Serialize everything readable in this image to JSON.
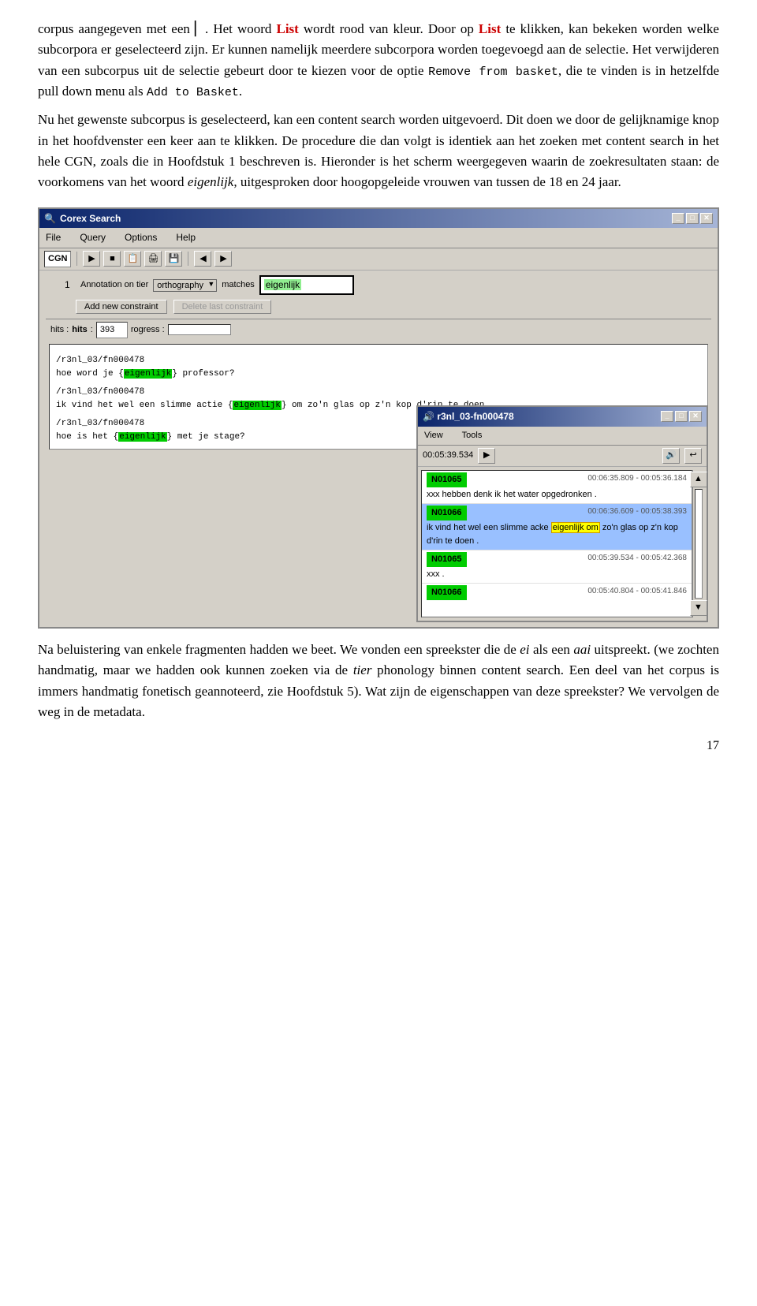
{
  "paragraph1": {
    "text": "corpus aangegeven met een"
  },
  "cursor_icon": "▏",
  "list_word": "List",
  "paragraph1_rest": ". Het woord List wordt rood van kleur. Door op List te klikken, kan bekeken worden welke subcorpora er geselecteerd zijn. Er kunnen namelijk meerdere subcorpora worden toegevoegd aan de selectie. Het verwijderen van een subcorpus uit de selectie gebeurt door te kiezen voor de optie",
  "remove_text": "Remove from basket",
  "remove_rest": ", die te vinden is in hetzelfde pull down menu als",
  "add_basket": "Add to Basket",
  "add_basket_rest": ".",
  "paragraph2": "Nu het gewenste subcorpus is geselecteerd, kan een content search worden uitgevoerd. Dit doen we door de gelijknamige knop in het hoofdvenster een keer aan te klikken. De procedure die dan volgt is identiek aan het zoeken met content search in het hele CGN, zoals die in Hoofdstuk 1 beschreven is. Hieronder is het scherm weergegeven waarin de zoekresultaten staan: de voorkomens van het woord",
  "eigenlijk_italic": "eigenlijk",
  "paragraph2_rest": ", uitgesproken door hoogopgeleide vrouwen van tussen de 18 en 24 jaar.",
  "corex_window": {
    "title": "Corex Search",
    "menu": [
      "File",
      "Query",
      "Options",
      "Help"
    ],
    "toolbar_corpus": "CGN",
    "query_row": {
      "number": "1",
      "annotation_label": "Annotation on tier",
      "tier_value": "orthography",
      "matches_label": "matches",
      "query_value": "eigenlijk"
    },
    "add_constraint_btn": "Add new constraint",
    "delete_constraint_btn": "Delete last constraint",
    "status": {
      "hits_label": "hits",
      "hits_colon": ":hits :",
      "hits_value": "393",
      "progress_label": "rogress :"
    },
    "results": [
      {
        "path": "/r3nl_03/fn000478",
        "text": "hoe word je {eigenlijk} professor?"
      },
      {
        "path": "/r3nl_03/fn000478",
        "text": "ik vind het wel een slimme actie {eigenlijk} om zo'n glas op z'n kop d'rin te doen."
      },
      {
        "path": "/r3nl_03/fn000478",
        "text": "hoe is het {eigenlijk} met je stage?"
      }
    ]
  },
  "sub_window": {
    "title": "r3nl_03-fn000478",
    "menu": [
      "View",
      "Tools"
    ],
    "time_display": "00:05:39.534",
    "items": [
      {
        "speaker": "N01065",
        "timestamp": "00:06:35.809 - 00:05:36.184",
        "text": "xxx hebben denk ik het water opgedronken .",
        "selected": false
      },
      {
        "speaker": "N01066",
        "timestamp": "00:06:36.609 - 00:05:38.393",
        "text": "ik vind het wel een slimme acke eigenlijk om zo'n glas op z'n kop d'rin te doen .",
        "selected": true
      },
      {
        "speaker": "N01065",
        "timestamp": "00:05:39.534 - 00:05:42.368",
        "text": "xxx .",
        "selected": false
      },
      {
        "speaker": "N01066",
        "timestamp": "00:05:40.804 - 00:05:41.846",
        "text": "",
        "selected": false
      }
    ]
  },
  "paragraph3": "Na beluistering van enkele fragmenten hadden we beet. We vonden een spreekster die de",
  "ei_italic": "ei",
  "as_text": "als een",
  "aai_italic": "aai",
  "paragraph3_rest": "uitspreekt. (we zochten handmatig, maar we hadden ook kunnen zoeken via de",
  "tier_italic": "tier",
  "paragraph3_rest2": "phonology binnen content search. Een deel van het corpus is immers handmatig fonetisch geannoteerd, zie Hoofdstuk 5). Wat zijn de eigenschappen van deze spreekster? We vervolgen de weg in de metadata.",
  "page_number": "17"
}
